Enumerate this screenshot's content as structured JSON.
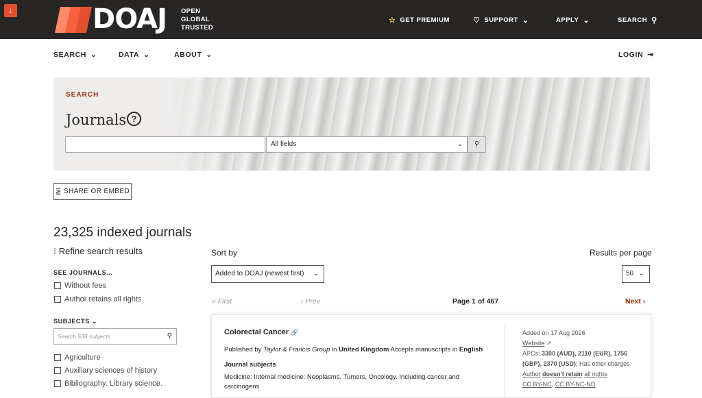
{
  "topbar": {
    "download_icon": "arrow-down-icon",
    "logo_word": "DOAJ",
    "tagline": [
      "OPEN",
      "GLOBAL",
      "TRUSTED"
    ],
    "premium": "GET PREMIUM",
    "support": "SUPPORT",
    "apply": "APPLY",
    "search": "SEARCH",
    "colors": {
      "bar": "#282624",
      "logo_stripes": [
        "#fe8a6a",
        "#f8613d",
        "#e2502d"
      ]
    }
  },
  "subnav": {
    "search": "SEARCH",
    "data": "DATA",
    "about": "ABOUT",
    "login": "LOGIN"
  },
  "hero": {
    "label": "SEARCH",
    "title": "Journals",
    "help": "?",
    "field_select": "All fields"
  },
  "share": "SHARE OR EMBED",
  "results": {
    "count": "23,325 indexed journals",
    "refine": "Refine search results",
    "see_journals": "SEE JOURNALS...",
    "filters": [
      "Without fees",
      "Author retains all rights"
    ],
    "subjects_heading": "SUBJECTS",
    "subjects_placeholder": "Search 538 subjects",
    "subjects": [
      "Agriculture",
      "Auxiliary sciences of history",
      "Bibliography. Library science."
    ]
  },
  "sort": {
    "label": "Sort by",
    "value": "Added to DOAJ (newest first)",
    "rpp_label": "Results per page",
    "rpp_value": "50"
  },
  "pagination": {
    "first": "First",
    "prev": "Prev",
    "page": "Page 1 of 467",
    "next": "Next"
  },
  "card": {
    "title": "Colorectal Cancer",
    "published_by": "Published by",
    "publisher": "Taylor & Francis Group",
    "in": "in",
    "country": "United Kingdom",
    "accepts": "Accepts manuscripts in",
    "language": "English",
    "subjects_heading": "Journal subjects",
    "subjects_text": "Medicine: Internal medicine: Neoplasms. Tumors. Oncology. Including cancer and carcinogens",
    "added": "Added on 17 Aug 2026",
    "website": "Website",
    "apcs_label": "APCs:",
    "apcs_values": "3300 (AUD), 2110 (EUR), 1756 (GBP), 2370 (USD)",
    "apcs_tail": "; Has other charges",
    "author": "Author",
    "doesnt_retain": "doesn't retain",
    "all_rights": "all rights",
    "licenses": [
      "CC BY-NC",
      "CC BY-NC-ND"
    ]
  }
}
